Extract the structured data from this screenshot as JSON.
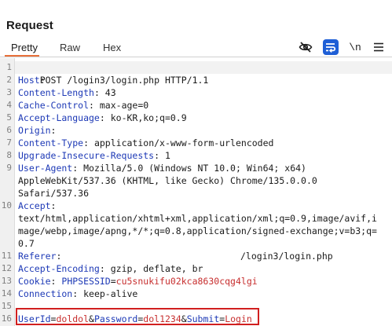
{
  "panel": {
    "title": "Request"
  },
  "tabs": [
    {
      "label": "Pretty",
      "active": true
    },
    {
      "label": "Raw",
      "active": false
    },
    {
      "label": "Hex",
      "active": false
    }
  ],
  "toolbar": {
    "hide_icon": "eye-slash-icon",
    "wrap_icon": "word-wrap-icon",
    "newline_label": "\\n",
    "menu_icon": "hamburger-menu-icon"
  },
  "colors": {
    "accent": "#e8703a",
    "header_name": "#1d39b6",
    "string_value": "#c72e2e",
    "highlight_border": "#d11f1f"
  },
  "line_numbers": [
    "1",
    "2",
    "3",
    "4",
    "5",
    "6",
    "7",
    "8",
    "9",
    "10",
    "11",
    "12",
    "13",
    "14",
    "15",
    "16"
  ],
  "request": {
    "request_line": "POST /login3/login.php HTTP/1.1",
    "headers": [
      {
        "name": "Host",
        "value": ""
      },
      {
        "name": "Content-Length",
        "value": "43"
      },
      {
        "name": "Cache-Control",
        "value": "max-age=0"
      },
      {
        "name": "Accept-Language",
        "value": "ko-KR,ko;q=0.9"
      },
      {
        "name": "Origin",
        "value": ""
      },
      {
        "name": "Content-Type",
        "value": "application/x-www-form-urlencoded"
      },
      {
        "name": "Upgrade-Insecure-Requests",
        "value": "1"
      },
      {
        "name": "User-Agent",
        "value": "Mozilla/5.0 (Windows NT 10.0; Win64; x64)",
        "cont": [
          "AppleWebKit/537.36 (KHTML, like Gecko) Chrome/135.0.0.0",
          "Safari/537.36"
        ]
      },
      {
        "name": "Accept",
        "value": "",
        "cont": [
          "text/html,application/xhtml+xml,application/xml;q=0.9,image/avif,i",
          "mage/webp,image/apng,*/*;q=0.8,application/signed-exchange;v=b3;q=",
          "0.7"
        ]
      },
      {
        "name": "Referer",
        "value": "/login3/login.php"
      },
      {
        "name": "Accept-Encoding",
        "value": "gzip, deflate, br"
      },
      {
        "name": "Cookie",
        "cookie_name": "PHPSESSID",
        "cookie_value": "cu5snukifu02kca8630cqg4lgi"
      },
      {
        "name": "Connection",
        "value": "keep-alive"
      }
    ],
    "body": {
      "params": [
        {
          "name": "UserId",
          "value": "doldol"
        },
        {
          "name": "Password",
          "value": "dol1234"
        },
        {
          "name": "Submit",
          "value": "Login"
        }
      ]
    }
  }
}
